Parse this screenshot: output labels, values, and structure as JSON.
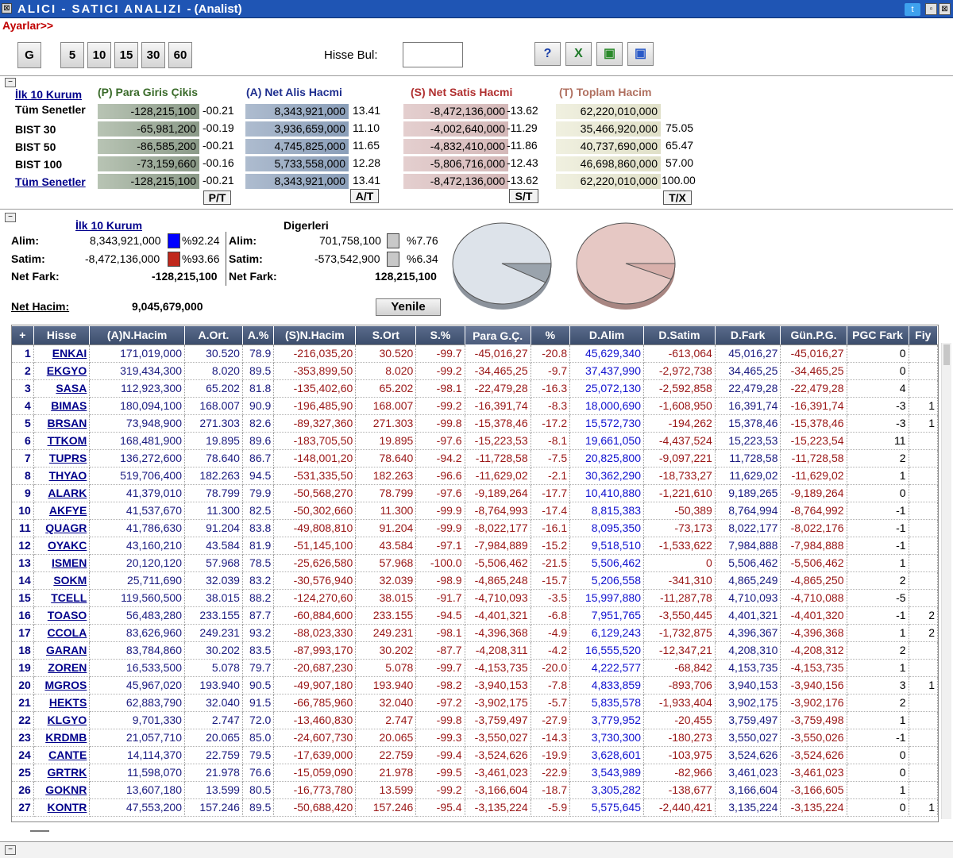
{
  "window": {
    "title_main": "ALICI - SATICI ANALIZI",
    "title_sub": "- (Analist)",
    "sys_icon": "x-icon",
    "right_icons": [
      "twitter-icon",
      "minimize-icon",
      "close-icon"
    ]
  },
  "toolbar": {
    "ayarlar": "Ayarlar>>",
    "period_buttons": [
      "G",
      "5",
      "10",
      "15",
      "30",
      "60"
    ],
    "hisse_bul_label": "Hisse Bul:",
    "hisse_bul_value": "",
    "icons": [
      "help-icon",
      "excel-icon",
      "green-stack-icon",
      "blue-stack-icon"
    ]
  },
  "summary": {
    "ilk10_link": "İlk 10 Kurum",
    "headers": {
      "P": "(P) Para Giris Çikis",
      "A": "(A) Net Alis Hacmi",
      "S": "(S) Net Satis Hacmi",
      "T": "(T) Toplam Hacim"
    },
    "rows": [
      {
        "label": "Tüm Senetler",
        "p": "-128,215,100",
        "pp": "-00.21",
        "a": "8,343,921,000",
        "ap": "13.41",
        "s": "-8,472,136,000",
        "sp": "-13.62",
        "t": "62,220,010,000",
        "tp": ""
      },
      {
        "label": "BIST 30",
        "p": "-65,981,200",
        "pp": "-00.19",
        "a": "3,936,659,000",
        "ap": "11.10",
        "s": "-4,002,640,000",
        "sp": "-11.29",
        "t": "35,466,920,000",
        "tp": "75.05"
      },
      {
        "label": "BIST 50",
        "p": "-86,585,200",
        "pp": "-00.21",
        "a": "4,745,825,000",
        "ap": "11.65",
        "s": "-4,832,410,000",
        "sp": "-11.86",
        "t": "40,737,690,000",
        "tp": "65.47"
      },
      {
        "label": "BIST 100",
        "p": "-73,159,660",
        "pp": "-00.16",
        "a": "5,733,558,000",
        "ap": "12.28",
        "s": "-5,806,716,000",
        "sp": "-12.43",
        "t": "46,698,860,000",
        "tp": "57.00"
      },
      {
        "label": "Tüm Senetler",
        "p": "-128,215,100",
        "pp": "-00.21",
        "a": "8,343,921,000",
        "ap": "13.41",
        "s": "-8,472,136,000",
        "sp": "-13.62",
        "t": "62,220,010,000",
        "tp": "100.00"
      }
    ],
    "ratio_buttons": {
      "pt": "P/T",
      "at": "A/T",
      "st": "S/T",
      "tx": "T/X"
    }
  },
  "compare": {
    "left_title": "İlk 10 Kurum",
    "right_title": "Digerleri",
    "alim_label": "Alim:",
    "satim_label": "Satim:",
    "net_fark_label": "Net Fark:",
    "left": {
      "alim": "8,343,921,000",
      "alim_pct": "%92.24",
      "satim": "-8,472,136,000",
      "satim_pct": "%93.66",
      "net_fark": "-128,215,100"
    },
    "right": {
      "alim": "701,758,100",
      "alim_pct": "%7.76",
      "satim": "-573,542,900",
      "satim_pct": "%6.34",
      "net_fark": "128,215,100"
    },
    "net_hacim_label": "Net Hacim:",
    "net_hacim": "9,045,679,000",
    "yenile": "Yenile",
    "colors": {
      "alim_left": "#0000ff",
      "satim_left": "#c0281c",
      "other": "#c8c8c8",
      "pie_left": "#dde3ea",
      "pie_right": "#e6c8c4"
    },
    "pie_fractions": {
      "left_small_slice": 0.0776,
      "right_small_slice": 0.0634
    }
  },
  "grid": {
    "columns": [
      "+",
      "Hisse",
      "(A)N.Hacim",
      "A.Ort.",
      "A.%",
      "(S)N.Hacim",
      "S.Ort",
      "S.%",
      "Para G.Ç.",
      "%",
      "D.Alim",
      "D.Satim",
      "D.Fark",
      "Gün.P.G.",
      "PGC Fark",
      "Fiy"
    ],
    "rows": [
      [
        "1",
        "ENKAI",
        "171,019,000",
        "30.520",
        "78.9",
        "-216,035,20",
        "30.520",
        "-99.7",
        "-45,016,27",
        "-20.8",
        "45,629,340",
        "-613,064",
        "45,016,27",
        "-45,016,27",
        "0",
        ""
      ],
      [
        "2",
        "EKGYO",
        "319,434,300",
        "8.020",
        "89.5",
        "-353,899,50",
        "8.020",
        "-99.2",
        "-34,465,25",
        "-9.7",
        "37,437,990",
        "-2,972,738",
        "34,465,25",
        "-34,465,25",
        "0",
        ""
      ],
      [
        "3",
        "SASA",
        "112,923,300",
        "65.202",
        "81.8",
        "-135,402,60",
        "65.202",
        "-98.1",
        "-22,479,28",
        "-16.3",
        "25,072,130",
        "-2,592,858",
        "22,479,28",
        "-22,479,28",
        "4",
        ""
      ],
      [
        "4",
        "BIMAS",
        "180,094,100",
        "168.007",
        "90.9",
        "-196,485,90",
        "168.007",
        "-99.2",
        "-16,391,74",
        "-8.3",
        "18,000,690",
        "-1,608,950",
        "16,391,74",
        "-16,391,74",
        "-3",
        "1"
      ],
      [
        "5",
        "BRSAN",
        "73,948,900",
        "271.303",
        "82.6",
        "-89,327,360",
        "271.303",
        "-99.8",
        "-15,378,46",
        "-17.2",
        "15,572,730",
        "-194,262",
        "15,378,46",
        "-15,378,46",
        "-3",
        "1"
      ],
      [
        "6",
        "TTKOM",
        "168,481,900",
        "19.895",
        "89.6",
        "-183,705,50",
        "19.895",
        "-97.6",
        "-15,223,53",
        "-8.1",
        "19,661,050",
        "-4,437,524",
        "15,223,53",
        "-15,223,54",
        "11",
        ""
      ],
      [
        "7",
        "TUPRS",
        "136,272,600",
        "78.640",
        "86.7",
        "-148,001,20",
        "78.640",
        "-94.2",
        "-11,728,58",
        "-7.5",
        "20,825,800",
        "-9,097,221",
        "11,728,58",
        "-11,728,58",
        "2",
        ""
      ],
      [
        "8",
        "THYAO",
        "519,706,400",
        "182.263",
        "94.5",
        "-531,335,50",
        "182.263",
        "-96.6",
        "-11,629,02",
        "-2.1",
        "30,362,290",
        "-18,733,27",
        "11,629,02",
        "-11,629,02",
        "1",
        ""
      ],
      [
        "9",
        "ALARK",
        "41,379,010",
        "78.799",
        "79.9",
        "-50,568,270",
        "78.799",
        "-97.6",
        "-9,189,264",
        "-17.7",
        "10,410,880",
        "-1,221,610",
        "9,189,265",
        "-9,189,264",
        "0",
        ""
      ],
      [
        "10",
        "AKFYE",
        "41,537,670",
        "11.300",
        "82.5",
        "-50,302,660",
        "11.300",
        "-99.9",
        "-8,764,993",
        "-17.4",
        "8,815,383",
        "-50,389",
        "8,764,994",
        "-8,764,992",
        "-1",
        ""
      ],
      [
        "11",
        "QUAGR",
        "41,786,630",
        "91.204",
        "83.8",
        "-49,808,810",
        "91.204",
        "-99.9",
        "-8,022,177",
        "-16.1",
        "8,095,350",
        "-73,173",
        "8,022,177",
        "-8,022,176",
        "-1",
        ""
      ],
      [
        "12",
        "OYAKC",
        "43,160,210",
        "43.584",
        "81.9",
        "-51,145,100",
        "43.584",
        "-97.1",
        "-7,984,889",
        "-15.2",
        "9,518,510",
        "-1,533,622",
        "7,984,888",
        "-7,984,888",
        "-1",
        ""
      ],
      [
        "13",
        "ISMEN",
        "20,120,120",
        "57.968",
        "78.5",
        "-25,626,580",
        "57.968",
        "-100.0",
        "-5,506,462",
        "-21.5",
        "5,506,462",
        "0",
        "5,506,462",
        "-5,506,462",
        "1",
        ""
      ],
      [
        "14",
        "SOKM",
        "25,711,690",
        "32.039",
        "83.2",
        "-30,576,940",
        "32.039",
        "-98.9",
        "-4,865,248",
        "-15.7",
        "5,206,558",
        "-341,310",
        "4,865,249",
        "-4,865,250",
        "2",
        ""
      ],
      [
        "15",
        "TCELL",
        "119,560,500",
        "38.015",
        "88.2",
        "-124,270,60",
        "38.015",
        "-91.7",
        "-4,710,093",
        "-3.5",
        "15,997,880",
        "-11,287,78",
        "4,710,093",
        "-4,710,088",
        "-5",
        ""
      ],
      [
        "16",
        "TOASO",
        "56,483,280",
        "233.155",
        "87.7",
        "-60,884,600",
        "233.155",
        "-94.5",
        "-4,401,321",
        "-6.8",
        "7,951,765",
        "-3,550,445",
        "4,401,321",
        "-4,401,320",
        "-1",
        "2"
      ],
      [
        "17",
        "CCOLA",
        "83,626,960",
        "249.231",
        "93.2",
        "-88,023,330",
        "249.231",
        "-98.1",
        "-4,396,368",
        "-4.9",
        "6,129,243",
        "-1,732,875",
        "4,396,367",
        "-4,396,368",
        "1",
        "2"
      ],
      [
        "18",
        "GARAN",
        "83,784,860",
        "30.202",
        "83.5",
        "-87,993,170",
        "30.202",
        "-87.7",
        "-4,208,311",
        "-4.2",
        "16,555,520",
        "-12,347,21",
        "4,208,310",
        "-4,208,312",
        "2",
        ""
      ],
      [
        "19",
        "ZOREN",
        "16,533,500",
        "5.078",
        "79.7",
        "-20,687,230",
        "5.078",
        "-99.7",
        "-4,153,735",
        "-20.0",
        "4,222,577",
        "-68,842",
        "4,153,735",
        "-4,153,735",
        "1",
        ""
      ],
      [
        "20",
        "MGROS",
        "45,967,020",
        "193.940",
        "90.5",
        "-49,907,180",
        "193.940",
        "-98.2",
        "-3,940,153",
        "-7.8",
        "4,833,859",
        "-893,706",
        "3,940,153",
        "-3,940,156",
        "3",
        "1"
      ],
      [
        "21",
        "HEKTS",
        "62,883,790",
        "32.040",
        "91.5",
        "-66,785,960",
        "32.040",
        "-97.2",
        "-3,902,175",
        "-5.7",
        "5,835,578",
        "-1,933,404",
        "3,902,175",
        "-3,902,176",
        "2",
        ""
      ],
      [
        "22",
        "KLGYO",
        "9,701,330",
        "2.747",
        "72.0",
        "-13,460,830",
        "2.747",
        "-99.8",
        "-3,759,497",
        "-27.9",
        "3,779,952",
        "-20,455",
        "3,759,497",
        "-3,759,498",
        "1",
        ""
      ],
      [
        "23",
        "KRDMB",
        "21,057,710",
        "20.065",
        "85.0",
        "-24,607,730",
        "20.065",
        "-99.3",
        "-3,550,027",
        "-14.3",
        "3,730,300",
        "-180,273",
        "3,550,027",
        "-3,550,026",
        "-1",
        ""
      ],
      [
        "24",
        "CANTE",
        "14,114,370",
        "22.759",
        "79.5",
        "-17,639,000",
        "22.759",
        "-99.4",
        "-3,524,626",
        "-19.9",
        "3,628,601",
        "-103,975",
        "3,524,626",
        "-3,524,626",
        "0",
        ""
      ],
      [
        "25",
        "GRTRK",
        "11,598,070",
        "21.978",
        "76.6",
        "-15,059,090",
        "21.978",
        "-99.5",
        "-3,461,023",
        "-22.9",
        "3,543,989",
        "-82,966",
        "3,461,023",
        "-3,461,023",
        "0",
        ""
      ],
      [
        "26",
        "GOKNR",
        "13,607,180",
        "13.599",
        "80.5",
        "-16,773,780",
        "13.599",
        "-99.2",
        "-3,166,604",
        "-18.7",
        "3,305,282",
        "-138,677",
        "3,166,604",
        "-3,166,605",
        "1",
        ""
      ],
      [
        "27",
        "KONTR",
        "47,553,200",
        "157.246",
        "89.5",
        "-50,688,420",
        "157.246",
        "-95.4",
        "-3,135,224",
        "-5.9",
        "5,575,645",
        "-2,440,421",
        "3,135,224",
        "-3,135,224",
        "0",
        "1"
      ]
    ]
  }
}
